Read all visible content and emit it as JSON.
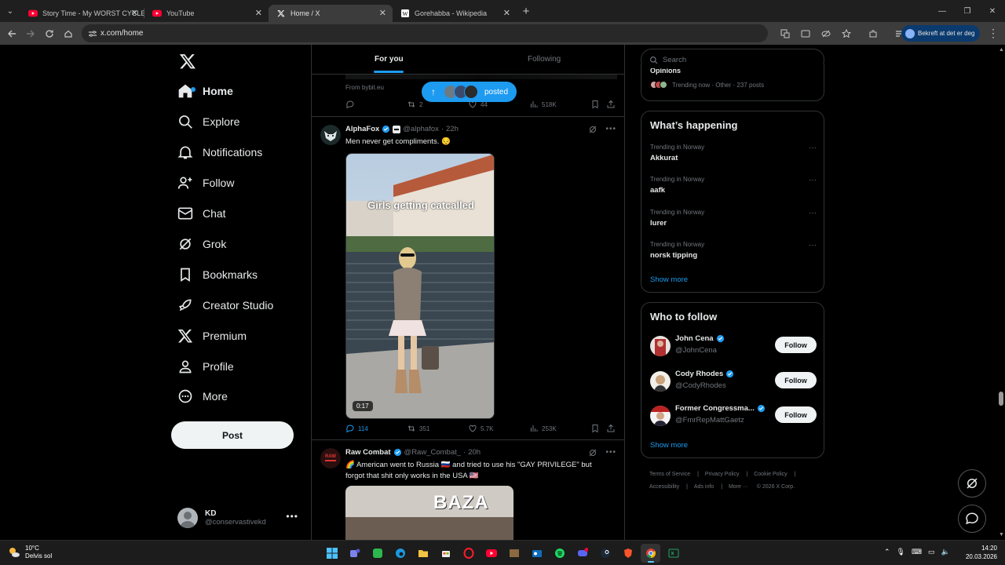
{
  "browser": {
    "tabs": [
      {
        "title": "Story Time - My WORST CYCLE",
        "favicon": "youtube-icon",
        "color": "#ff0033",
        "active": false
      },
      {
        "title": "YouTube",
        "favicon": "youtube-icon",
        "color": "#ff0033",
        "active": false
      },
      {
        "title": "Home / X",
        "favicon": "x-logo-icon",
        "color": "#ffffff",
        "active": true
      },
      {
        "title": "Gorehabba - Wikipedia",
        "favicon": "wikipedia-icon",
        "color": "#ffffff",
        "active": false
      }
    ],
    "url": "x.com/home",
    "profile_label": "Bekreft at det er deg"
  },
  "nav": {
    "items": [
      {
        "label": "Home",
        "icon": "home-icon"
      },
      {
        "label": "Explore",
        "icon": "search-icon"
      },
      {
        "label": "Notifications",
        "icon": "bell-icon"
      },
      {
        "label": "Follow",
        "icon": "person-add-icon"
      },
      {
        "label": "Chat",
        "icon": "mail-icon"
      },
      {
        "label": "Grok",
        "icon": "grok-icon"
      },
      {
        "label": "Bookmarks",
        "icon": "bookmark-icon"
      },
      {
        "label": "Creator Studio",
        "icon": "rocket-icon"
      },
      {
        "label": "Premium",
        "icon": "x-logo-icon"
      },
      {
        "label": "Profile",
        "icon": "person-icon"
      },
      {
        "label": "More",
        "icon": "more-circle-icon"
      }
    ],
    "post_label": "Post",
    "account": {
      "name": "KD",
      "handle": "@conservastivekd"
    }
  },
  "feed": {
    "tabs": [
      "For you",
      "Following"
    ],
    "posted_pill": "posted",
    "prev_tweet": {
      "source": "From bybit.eu",
      "stats": {
        "reply": "",
        "retweet": "2",
        "like": "44",
        "views": "518K"
      }
    },
    "tweets": [
      {
        "name": "AlphaFox",
        "handle": "@alphafox",
        "time": "22h",
        "text": "Men never get compliments. 😔",
        "media_caption": "Girls getting catcalled",
        "duration": "0:17",
        "stats": {
          "reply": "114",
          "retweet": "351",
          "like": "5.7K",
          "views": "253K"
        }
      },
      {
        "name": "Raw Combat",
        "handle": "@Raw_Combat_",
        "time": "20h",
        "text_line1": "🌈 American went to Russia 🇷🇺 and tried to use his \"GAY PRIVILEGE\" but",
        "text_line2": "forgot that shit only works in the USA 🇺🇸",
        "media_caption": "BAZA"
      }
    ]
  },
  "sidebar": {
    "search_placeholder": "Search",
    "trending_top": {
      "title": "Opinions",
      "meta": "Trending now · Other · 237 posts"
    },
    "whats_happening": {
      "title": "What’s happening",
      "trends": [
        {
          "context": "Trending in Norway",
          "name": "Akkurat"
        },
        {
          "context": "Trending in Norway",
          "name": "aafk"
        },
        {
          "context": "Trending in Norway",
          "name": "lurer"
        },
        {
          "context": "Trending in Norway",
          "name": "norsk tipping"
        }
      ],
      "show_more": "Show more"
    },
    "who_to_follow": {
      "title": "Who to follow",
      "accounts": [
        {
          "name": "John Cena",
          "handle": "@JohnCena",
          "button": "Follow"
        },
        {
          "name": "Cody Rhodes",
          "handle": "@CodyRhodes",
          "button": "Follow"
        },
        {
          "name": "Former Congressma...",
          "handle": "@FmrRepMattGaetz",
          "button": "Follow"
        }
      ],
      "show_more": "Show more"
    },
    "footer": [
      "Terms of Service",
      "Privacy Policy",
      "Cookie Policy",
      "Accessibility",
      "Ads info",
      "More ···",
      "© 2026 X Corp."
    ]
  },
  "taskbar": {
    "weather_temp": "10°C",
    "weather_desc": "Delvis sol",
    "time": "14:20",
    "date": "20.03.2026"
  },
  "colors": {
    "accent": "#1d9bf0",
    "border": "#2f3336",
    "muted": "#71767b"
  }
}
